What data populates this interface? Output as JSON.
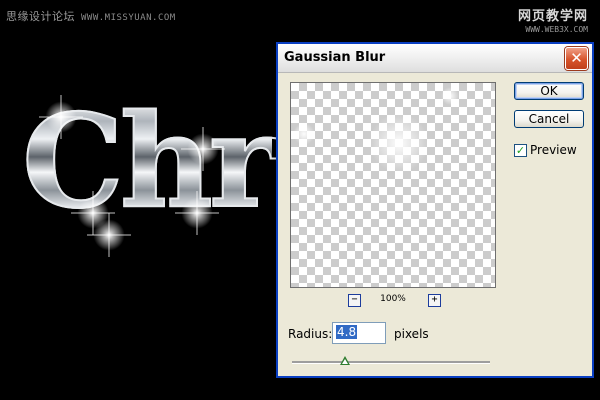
{
  "watermarks": {
    "top_left": "思缘设计论坛",
    "top_left_url": "WWW.MISSYUAN.COM",
    "top_right": "网页教学网",
    "top_right_url": "WWW.WEB3X.COM"
  },
  "artwork": {
    "text": "Chr"
  },
  "dialog": {
    "title": "Gaussian Blur",
    "close_glyph": "✕",
    "buttons": {
      "ok": "OK",
      "cancel": "Cancel"
    },
    "preview_checkbox": {
      "label": "Preview",
      "checked": true,
      "check_glyph": "✓"
    },
    "zoom": {
      "minus": "−",
      "level": "100%",
      "plus": "+"
    },
    "radius": {
      "label": "Radius:",
      "value": "4.8",
      "units": "pixels"
    },
    "slider": {
      "fraction": 0.27
    }
  },
  "colors": {
    "title_bar_border": "#0a3fc2",
    "dialog_bg": "#ece9d8",
    "close_button": "#d8542c",
    "selection": "#316ac5",
    "slider_thumb": "#2f7d2f",
    "checkmark": "#21a121"
  }
}
